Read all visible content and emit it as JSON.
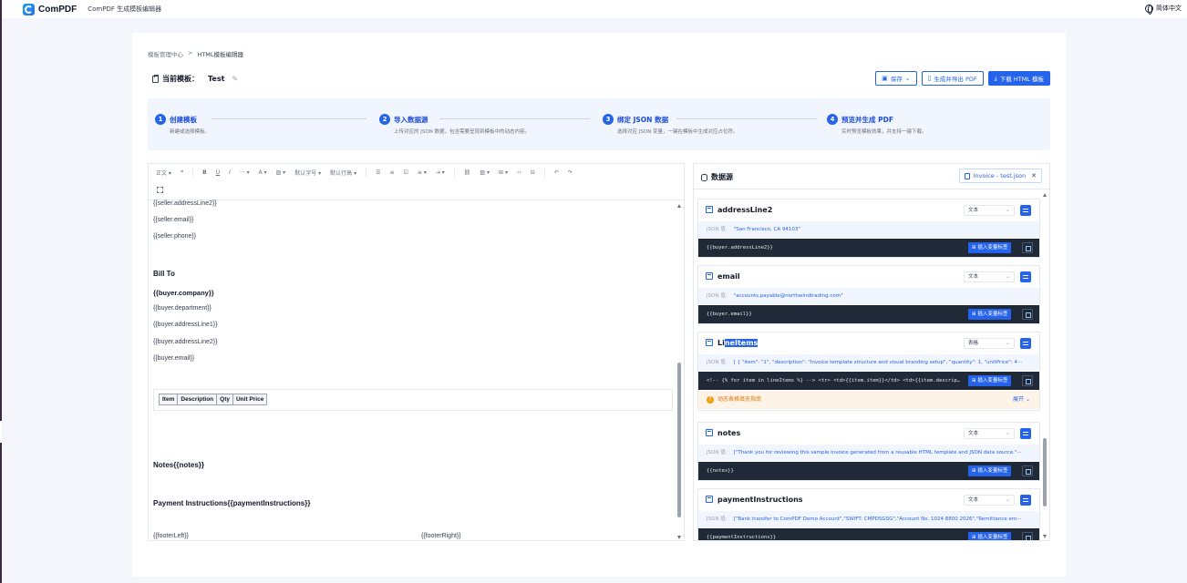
{
  "app": {
    "name": "ComPDF",
    "subtitle": "ComPDF 生成模板编辑器",
    "language": "简体中文"
  },
  "breadcrumb": {
    "parent": "模板管理中心",
    "separator": ">",
    "current": "HTML模板编辑器"
  },
  "template": {
    "label": "当前模板：",
    "name": "Test"
  },
  "actions": {
    "save": "保存",
    "export": "生成并导出 PDF",
    "download": "下载 HTML 模板"
  },
  "steps": [
    {
      "num": "1",
      "title": "创建模板",
      "desc": "新建或选择模板。"
    },
    {
      "num": "2",
      "title": "导入数据源",
      "desc": "上传对应的 JSON 数据，包含需要呈现到模板中的动态内容。"
    },
    {
      "num": "3",
      "title": "绑定 JSON 数据",
      "desc": "选择对应 JSON 变量，一键在模板中生成对应占位符。"
    },
    {
      "num": "4",
      "title": "预览并生成 PDF",
      "desc": "实时预览模板效果，并支持一键下载。"
    }
  ],
  "toolbar": {
    "paragraph": "正文",
    "font_size": "默认字号",
    "line_height": "默认行高"
  },
  "editor": {
    "lines": [
      "{{seller.addressLine2}}",
      "{{seller.email}}",
      "{{seller.phone}}",
      "Bill To",
      "{{buyer.company}}",
      "{{buyer.department}}",
      "{{buyer.addressLine1}}",
      "{{buyer.addressLine2}}",
      "{{buyer.email}}"
    ],
    "table_headers": [
      "Item",
      "Description",
      "Qty",
      "Unit Price"
    ],
    "notes": "Notes{{notes}}",
    "payment": "Payment Instructions{{paymentInstructions}}",
    "footer_left": "{{footerLeft}}",
    "footer_right": "{{footerRight}}"
  },
  "datasource": {
    "title": "数据源",
    "file": "Invoice - test.json",
    "json_key": "JSON 值:",
    "insert_label": "插入变量标签",
    "fields": [
      {
        "name": "addressLine2",
        "type": "文本",
        "json": "\"San Francisco, CA 94103\"",
        "code": "{{buyer.addressLine2}}"
      },
      {
        "name": "email",
        "type": "文本",
        "json": "\"accounts.payable@northwindtrading.com\"",
        "code": "{{buyer.email}}"
      },
      {
        "name_pre": "Li",
        "name_hl": "neItems",
        "type": "表格",
        "json": "[ { \"item\": \"1\", \"description\": \"Invoice template structure and visual branding setup\", \"quantity\": 1, \"unitPrice\": 4···",
        "code": "<!-- {% for item in lineItems %} --> <tr> <td>{{item.item}}</td> <td>{{item.descrip…",
        "warn": "动态表格填充指南",
        "expand": "展开"
      },
      {
        "name": "notes",
        "type": "文本",
        "json": "[\"Thank you for reviewing this sample invoice generated from a reusable HTML template and JSON data source.\"···",
        "code": "{{notes}}"
      },
      {
        "name": "paymentInstructions",
        "type": "文本",
        "json": "[\"Bank transfer to ComPDF Demo Account\",\"SWIFT: CMPDSGSG\",\"Account No. 1024 8800 2026\",\"Remittance em···",
        "code": "{{paymentInstructions}}"
      }
    ]
  },
  "colors": {
    "accent": "#2563eb",
    "code_bg": "#1f2937",
    "warn": "#f59e0b"
  }
}
